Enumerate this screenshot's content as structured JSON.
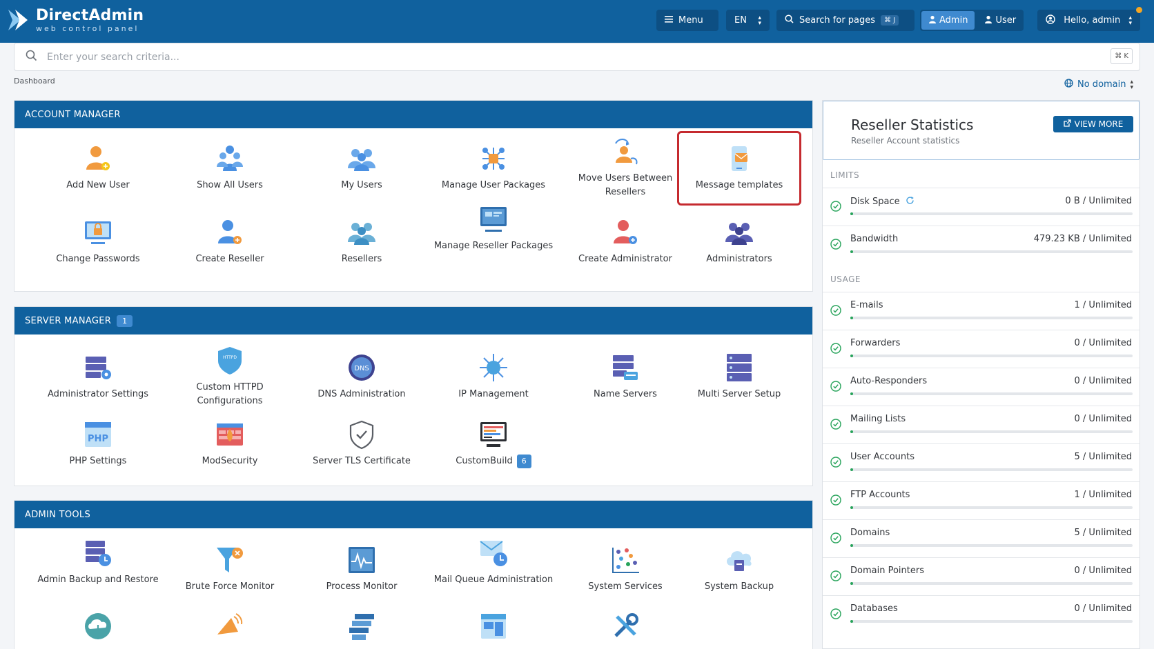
{
  "app": {
    "brand": "DirectAdmin",
    "tagline": "web control panel"
  },
  "topbar": {
    "menu_label": "Menu",
    "lang": "EN",
    "search_pages": "Search for pages",
    "search_pages_kbd": "⌘ J",
    "admin_label": "Admin",
    "user_label": "User",
    "greeting": "Hello, admin"
  },
  "search": {
    "placeholder": "Enter your search criteria...",
    "kbd": "⌘ K"
  },
  "breadcrumb": "Dashboard",
  "domain_selector": "No domain",
  "colors": {
    "primary": "#10619e",
    "highlight": "#c52a2f",
    "success": "#27a35a"
  },
  "account_manager": {
    "title": "ACCOUNT MANAGER",
    "items": [
      {
        "label": "Add New User",
        "icon": "add-user-icon"
      },
      {
        "label": "Show All Users",
        "icon": "users-icon"
      },
      {
        "label": "My Users",
        "icon": "my-users-icon"
      },
      {
        "label": "Manage User Packages",
        "icon": "packages-icon"
      },
      {
        "label": "Move Users Between Resellers",
        "icon": "move-users-icon"
      },
      {
        "label": "Message templates",
        "icon": "message-template-icon"
      },
      {
        "label": "Change Passwords",
        "icon": "lock-monitor-icon"
      },
      {
        "label": "Create Reseller",
        "icon": "create-reseller-icon"
      },
      {
        "label": "Resellers",
        "icon": "resellers-icon"
      },
      {
        "label": "Manage Reseller Packages",
        "icon": "reseller-packages-icon"
      },
      {
        "label": "Create Administrator",
        "icon": "create-admin-icon"
      },
      {
        "label": "Administrators",
        "icon": "administrators-icon"
      }
    ]
  },
  "server_manager": {
    "title": "SERVER MANAGER",
    "badge": "1",
    "items": [
      {
        "label": "Administrator Settings",
        "icon": "admin-settings-icon"
      },
      {
        "label": "Custom HTTPD Configurations",
        "icon": "httpd-shield-icon"
      },
      {
        "label": "DNS Administration",
        "icon": "dns-globe-icon"
      },
      {
        "label": "IP Management",
        "icon": "ip-network-icon"
      },
      {
        "label": "Name Servers",
        "icon": "name-servers-icon"
      },
      {
        "label": "Multi Server Setup",
        "icon": "multi-server-icon"
      },
      {
        "label": "PHP Settings",
        "icon": "php-icon"
      },
      {
        "label": "ModSecurity",
        "icon": "modsecurity-icon"
      },
      {
        "label": "Server TLS Certificate",
        "icon": "tls-shield-icon"
      },
      {
        "label": "CustomBuild",
        "icon": "custombuild-icon",
        "badge": "6"
      }
    ]
  },
  "admin_tools": {
    "title": "ADMIN TOOLS",
    "items": [
      {
        "label": "Admin Backup and Restore",
        "icon": "backup-restore-icon"
      },
      {
        "label": "Brute Force Monitor",
        "icon": "brute-force-icon"
      },
      {
        "label": "Process Monitor",
        "icon": "process-monitor-icon"
      },
      {
        "label": "Mail Queue Administration",
        "icon": "mail-queue-icon"
      },
      {
        "label": "System Services",
        "icon": "system-services-icon"
      },
      {
        "label": "System Backup",
        "icon": "system-backup-icon"
      }
    ]
  },
  "reseller_stats": {
    "title": "Reseller Statistics",
    "subtitle": "Reseller Account statistics",
    "view_more": "VIEW MORE",
    "limits_label": "LIMITS",
    "usage_label": "USAGE",
    "limits": [
      {
        "name": "Disk Space",
        "value": "0 B / Unlimited"
      },
      {
        "name": "Bandwidth",
        "value": "479.23 KB / Unlimited"
      }
    ],
    "usage": [
      {
        "name": "E-mails",
        "value": "1 / Unlimited"
      },
      {
        "name": "Forwarders",
        "value": "0 / Unlimited"
      },
      {
        "name": "Auto-Responders",
        "value": "0 / Unlimited"
      },
      {
        "name": "Mailing Lists",
        "value": "0 / Unlimited"
      },
      {
        "name": "User Accounts",
        "value": "5 / Unlimited"
      },
      {
        "name": "FTP Accounts",
        "value": "1 / Unlimited"
      },
      {
        "name": "Domains",
        "value": "5 / Unlimited"
      },
      {
        "name": "Domain Pointers",
        "value": "0 / Unlimited"
      },
      {
        "name": "Databases",
        "value": "0 / Unlimited"
      }
    ]
  }
}
